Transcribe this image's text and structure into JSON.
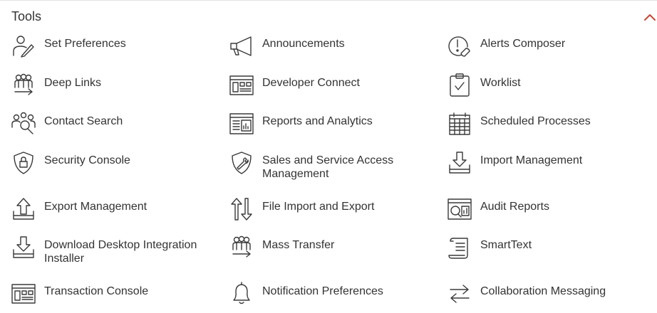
{
  "panel": {
    "title": "Tools",
    "collapse_icon": "chevron-up-icon",
    "accent_color": "#c74634"
  },
  "items": [
    {
      "label": "Set Preferences",
      "icon": "person-pencil-icon"
    },
    {
      "label": "Announcements",
      "icon": "megaphone-icon"
    },
    {
      "label": "Alerts Composer",
      "icon": "alert-wrench-icon"
    },
    {
      "label": "Deep Links",
      "icon": "group-arrow-icon"
    },
    {
      "label": "Developer Connect",
      "icon": "window-panels-icon"
    },
    {
      "label": "Worklist",
      "icon": "clipboard-check-icon"
    },
    {
      "label": "Contact Search",
      "icon": "people-search-icon"
    },
    {
      "label": "Reports and Analytics",
      "icon": "report-chart-icon"
    },
    {
      "label": "Scheduled Processes",
      "icon": "calendar-grid-icon"
    },
    {
      "label": "Security Console",
      "icon": "shield-lock-icon"
    },
    {
      "label": "Sales and Service Access Management",
      "icon": "shield-wrench-icon"
    },
    {
      "label": "Import Management",
      "icon": "download-tray-icon"
    },
    {
      "label": "Export Management",
      "icon": "upload-tray-icon"
    },
    {
      "label": "File Import and Export",
      "icon": "up-down-arrows-icon"
    },
    {
      "label": "Audit Reports",
      "icon": "report-chart-icon"
    },
    {
      "label": "Download Desktop Integration Installer",
      "icon": "download-tray-icon"
    },
    {
      "label": "Mass Transfer",
      "icon": "group-arrow-icon"
    },
    {
      "label": "SmartText",
      "icon": "scroll-icon"
    },
    {
      "label": "Transaction Console",
      "icon": "window-panels-icon"
    },
    {
      "label": "Notification Preferences",
      "icon": "bell-icon"
    },
    {
      "label": "Collaboration Messaging",
      "icon": "swap-arrows-icon"
    }
  ]
}
